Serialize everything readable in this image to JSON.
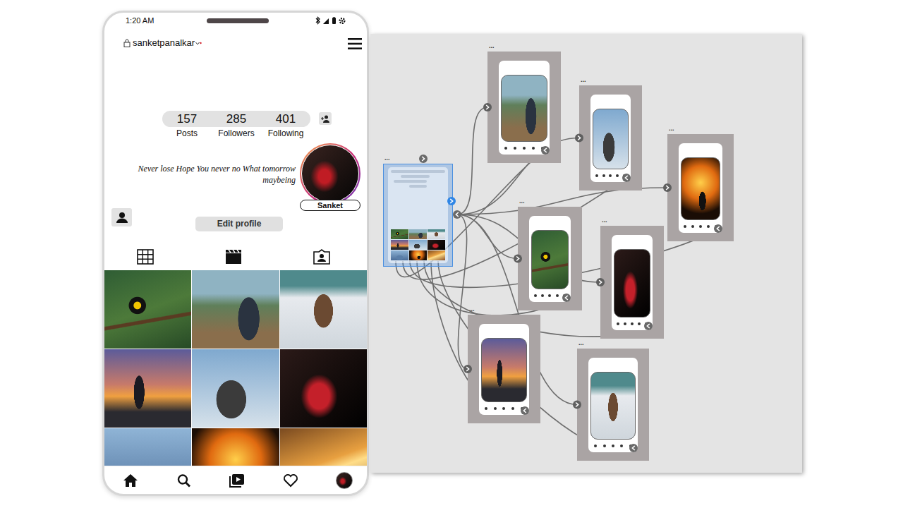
{
  "status_bar": {
    "time": "1:20 AM"
  },
  "profile": {
    "username": "sanketpanalkar",
    "stats": [
      {
        "value": "157",
        "label": "Posts"
      },
      {
        "value": "285",
        "label": "Followers"
      },
      {
        "value": "401",
        "label": "Following"
      }
    ],
    "bio": [
      "Never lose Hope You never no What tomorrow",
      "maybeing"
    ],
    "display_name": "Sanket",
    "edit_button": "Edit profile"
  },
  "canvas": {
    "frames": [
      {
        "label": "...",
        "selected": true
      },
      {
        "label": "...",
        "selected": false
      },
      {
        "label": "...",
        "selected": false
      },
      {
        "label": "...",
        "selected": false
      },
      {
        "label": "...",
        "selected": false
      },
      {
        "label": "...",
        "selected": false
      },
      {
        "label": "...",
        "selected": false
      },
      {
        "label": "...",
        "selected": false
      }
    ],
    "connections": [
      {
        "from": 0,
        "to": 1
      },
      {
        "from": 0,
        "to": 2
      },
      {
        "from": 0,
        "to": 3
      },
      {
        "from": 0,
        "to": 4
      },
      {
        "from": 0,
        "to": 5
      },
      {
        "from": 0,
        "to": 6
      },
      {
        "from": 0,
        "to": 7
      },
      {
        "from": 1,
        "to": 0
      },
      {
        "from": 2,
        "to": 0
      },
      {
        "from": 3,
        "to": 0
      },
      {
        "from": 4,
        "to": 0
      },
      {
        "from": 5,
        "to": 0
      },
      {
        "from": 6,
        "to": 0
      },
      {
        "from": 7,
        "to": 0
      }
    ]
  }
}
